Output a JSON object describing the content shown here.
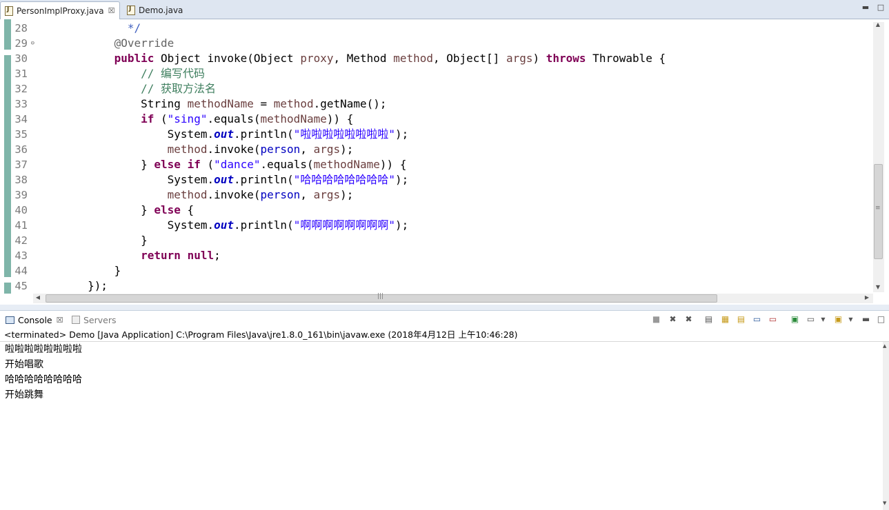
{
  "editor_tabs": [
    {
      "label": "PersonImplProxy.java",
      "active": true,
      "close": "☒"
    },
    {
      "label": "Demo.java",
      "active": false
    }
  ],
  "line_numbers": [
    "28",
    "29",
    "30",
    "31",
    "32",
    "33",
    "34",
    "35",
    "36",
    "37",
    "38",
    "39",
    "40",
    "41",
    "42",
    "43",
    "44",
    "45"
  ],
  "fold_marks": {
    "29": "⊖"
  },
  "code_lines": [
    [
      {
        "t": "              "
      },
      {
        "t": "*/",
        "c": "jd"
      }
    ],
    [
      {
        "t": "            "
      },
      {
        "t": "@Override",
        "c": "an"
      }
    ],
    [
      {
        "t": "            "
      },
      {
        "t": "public",
        "c": "kw"
      },
      {
        "t": " Object invoke(Object "
      },
      {
        "t": "proxy",
        "c": "vr"
      },
      {
        "t": ", Method "
      },
      {
        "t": "method",
        "c": "vr"
      },
      {
        "t": ", Object[] "
      },
      {
        "t": "args",
        "c": "vr"
      },
      {
        "t": ") "
      },
      {
        "t": "throws",
        "c": "kw"
      },
      {
        "t": " Throwable {"
      }
    ],
    [
      {
        "t": "                "
      },
      {
        "t": "// 编写代码",
        "c": "cm"
      }
    ],
    [
      {
        "t": "                "
      },
      {
        "t": "// 获取方法名",
        "c": "cm"
      }
    ],
    [
      {
        "t": "                String "
      },
      {
        "t": "methodName",
        "c": "vr"
      },
      {
        "t": " = "
      },
      {
        "t": "method",
        "c": "vr"
      },
      {
        "t": ".getName();"
      }
    ],
    [
      {
        "t": "                "
      },
      {
        "t": "if",
        "c": "kw"
      },
      {
        "t": " ("
      },
      {
        "t": "\"sing\"",
        "c": "st"
      },
      {
        "t": ".equals("
      },
      {
        "t": "methodName",
        "c": "vr"
      },
      {
        "t": ")) {"
      }
    ],
    [
      {
        "t": "                    System."
      },
      {
        "t": "out",
        "c": "sf"
      },
      {
        "t": ".println("
      },
      {
        "t": "\"啦啦啦啦啦啦啦啦\"",
        "c": "st"
      },
      {
        "t": ");"
      }
    ],
    [
      {
        "t": "                    "
      },
      {
        "t": "method",
        "c": "vr"
      },
      {
        "t": ".invoke("
      },
      {
        "t": "person",
        "c": "fd"
      },
      {
        "t": ", "
      },
      {
        "t": "args",
        "c": "vr"
      },
      {
        "t": ");"
      }
    ],
    [
      {
        "t": "                } "
      },
      {
        "t": "else",
        "c": "kw"
      },
      {
        "t": " "
      },
      {
        "t": "if",
        "c": "kw"
      },
      {
        "t": " ("
      },
      {
        "t": "\"dance\"",
        "c": "st"
      },
      {
        "t": ".equals("
      },
      {
        "t": "methodName",
        "c": "vr"
      },
      {
        "t": ")) {"
      }
    ],
    [
      {
        "t": "                    System."
      },
      {
        "t": "out",
        "c": "sf"
      },
      {
        "t": ".println("
      },
      {
        "t": "\"哈哈哈哈哈哈哈哈\"",
        "c": "st"
      },
      {
        "t": ");"
      }
    ],
    [
      {
        "t": "                    "
      },
      {
        "t": "method",
        "c": "vr"
      },
      {
        "t": ".invoke("
      },
      {
        "t": "person",
        "c": "fd"
      },
      {
        "t": ", "
      },
      {
        "t": "args",
        "c": "vr"
      },
      {
        "t": ");"
      }
    ],
    [
      {
        "t": "                } "
      },
      {
        "t": "else",
        "c": "kw"
      },
      {
        "t": " {"
      }
    ],
    [
      {
        "t": "                    System."
      },
      {
        "t": "out",
        "c": "sf"
      },
      {
        "t": ".println("
      },
      {
        "t": "\"啊啊啊啊啊啊啊啊\"",
        "c": "st"
      },
      {
        "t": ");"
      }
    ],
    [
      {
        "t": "                }"
      }
    ],
    [
      {
        "t": "                "
      },
      {
        "t": "return",
        "c": "kw"
      },
      {
        "t": " "
      },
      {
        "t": "null",
        "c": "kw"
      },
      {
        "t": ";"
      }
    ],
    [
      {
        "t": "            }"
      }
    ],
    [
      {
        "t": "        });"
      }
    ]
  ],
  "scroll": {
    "h_grip": "|||",
    "v_grip": "≡"
  },
  "console": {
    "tabs": [
      {
        "label": "Console",
        "close": "☒"
      },
      {
        "label": "Servers"
      }
    ],
    "status": "<terminated> Demo [Java Application] C:\\Program Files\\Java\\jre1.8.0_161\\bin\\javaw.exe (2018年4月12日 上午10:46:28)",
    "output": [
      "啦啦啦啦啦啦啦啦",
      "开始唱歌",
      "哈哈哈哈哈哈哈哈",
      "开始跳舞"
    ]
  },
  "toolbar_icons": [
    "terminate-icon",
    "remove-launch-icon",
    "remove-all-icon",
    "clear-console-icon",
    "scroll-lock-icon",
    "word-wrap-icon",
    "show-stdout-icon",
    "show-stderr-icon",
    "pin-console-icon",
    "display-console-icon",
    "open-console-icon"
  ],
  "colors": {
    "keyword": "#7f0055",
    "comment": "#3f7f5f",
    "string": "#2a00ff",
    "variable": "#6a3e3e",
    "field": "#0000c0",
    "change_bar": "#7fb5a9"
  }
}
